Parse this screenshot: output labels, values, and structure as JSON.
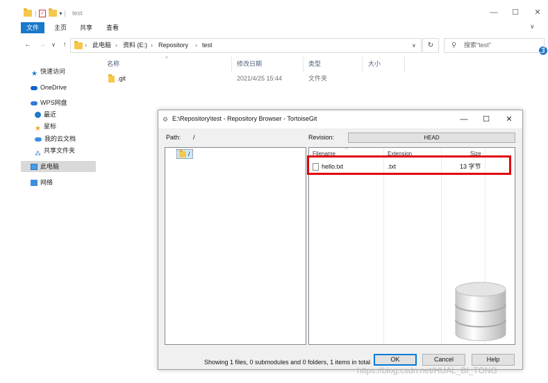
{
  "explorer": {
    "window_title": "test",
    "ribbon_tabs": [
      "文件",
      "主页",
      "共享",
      "查看"
    ],
    "breadcrumb": [
      "此电脑",
      "资料 (E:)",
      "Repository",
      "test"
    ],
    "search_placeholder": "搜索\"test\"",
    "sidebar": {
      "quick_access": "快速访问",
      "onedrive": "OneDrive",
      "wps": "WPS网盘",
      "recent": "最近",
      "starred": "星标",
      "my_cloud": "我的云文档",
      "shared": "共享文件夹",
      "this_pc": "此电脑",
      "network": "网络"
    },
    "columns": {
      "name": "名称",
      "modified": "修改日期",
      "type": "类型",
      "size": "大小"
    },
    "files": [
      {
        "name": ".git",
        "modified": "2021/4/25 15:44",
        "type": "文件夹",
        "size": ""
      }
    ]
  },
  "repo_browser": {
    "title": "E:\\Repository\\test - Repository Browser - TortoiseGit",
    "path_label": "Path:",
    "path_value": "/",
    "revision_label": "Revision:",
    "revision_value": "HEAD",
    "tree_root": "/",
    "columns": {
      "filename": "Filename",
      "extension": "Extension",
      "size": "Size"
    },
    "files": [
      {
        "filename": "hello.txt",
        "extension": ".txt",
        "size": "13 字节"
      }
    ],
    "status_text": "Showing 1 files, 0 submodules and 0 folders, 1 items in total",
    "ok_label": "OK",
    "cancel_label": "Cancel",
    "help_label": "Help"
  },
  "watermark": "https://blog.csdn.net/HUAL_BI_TONG",
  "colors": {
    "accent": "#1979ca",
    "highlight": "#e0000b",
    "folder": "#f5c84c"
  }
}
